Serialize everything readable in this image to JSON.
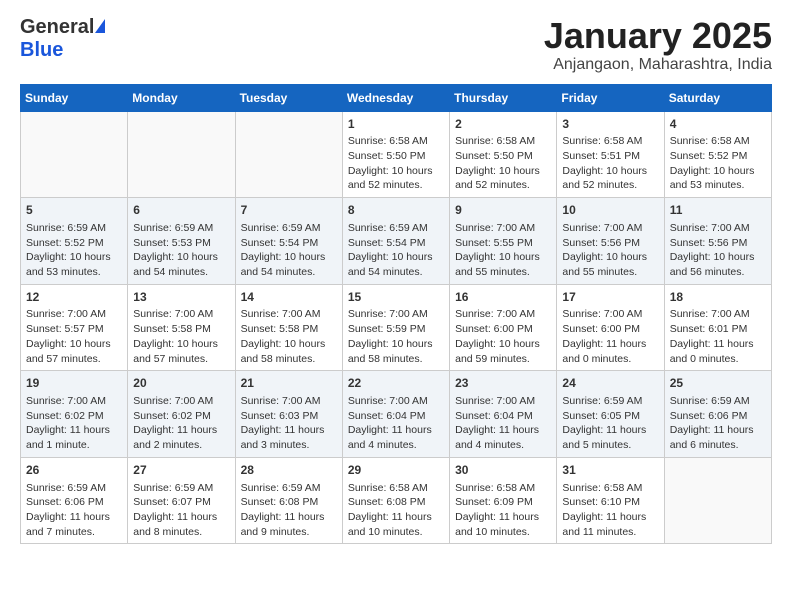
{
  "header": {
    "logo_general": "General",
    "logo_blue": "Blue",
    "month": "January 2025",
    "location": "Anjangaon, Maharashtra, India"
  },
  "weekdays": [
    "Sunday",
    "Monday",
    "Tuesday",
    "Wednesday",
    "Thursday",
    "Friday",
    "Saturday"
  ],
  "weeks": [
    [
      {
        "day": "",
        "lines": []
      },
      {
        "day": "",
        "lines": []
      },
      {
        "day": "",
        "lines": []
      },
      {
        "day": "1",
        "lines": [
          "Sunrise: 6:58 AM",
          "Sunset: 5:50 PM",
          "Daylight: 10 hours",
          "and 52 minutes."
        ]
      },
      {
        "day": "2",
        "lines": [
          "Sunrise: 6:58 AM",
          "Sunset: 5:50 PM",
          "Daylight: 10 hours",
          "and 52 minutes."
        ]
      },
      {
        "day": "3",
        "lines": [
          "Sunrise: 6:58 AM",
          "Sunset: 5:51 PM",
          "Daylight: 10 hours",
          "and 52 minutes."
        ]
      },
      {
        "day": "4",
        "lines": [
          "Sunrise: 6:58 AM",
          "Sunset: 5:52 PM",
          "Daylight: 10 hours",
          "and 53 minutes."
        ]
      }
    ],
    [
      {
        "day": "5",
        "lines": [
          "Sunrise: 6:59 AM",
          "Sunset: 5:52 PM",
          "Daylight: 10 hours",
          "and 53 minutes."
        ]
      },
      {
        "day": "6",
        "lines": [
          "Sunrise: 6:59 AM",
          "Sunset: 5:53 PM",
          "Daylight: 10 hours",
          "and 54 minutes."
        ]
      },
      {
        "day": "7",
        "lines": [
          "Sunrise: 6:59 AM",
          "Sunset: 5:54 PM",
          "Daylight: 10 hours",
          "and 54 minutes."
        ]
      },
      {
        "day": "8",
        "lines": [
          "Sunrise: 6:59 AM",
          "Sunset: 5:54 PM",
          "Daylight: 10 hours",
          "and 54 minutes."
        ]
      },
      {
        "day": "9",
        "lines": [
          "Sunrise: 7:00 AM",
          "Sunset: 5:55 PM",
          "Daylight: 10 hours",
          "and 55 minutes."
        ]
      },
      {
        "day": "10",
        "lines": [
          "Sunrise: 7:00 AM",
          "Sunset: 5:56 PM",
          "Daylight: 10 hours",
          "and 55 minutes."
        ]
      },
      {
        "day": "11",
        "lines": [
          "Sunrise: 7:00 AM",
          "Sunset: 5:56 PM",
          "Daylight: 10 hours",
          "and 56 minutes."
        ]
      }
    ],
    [
      {
        "day": "12",
        "lines": [
          "Sunrise: 7:00 AM",
          "Sunset: 5:57 PM",
          "Daylight: 10 hours",
          "and 57 minutes."
        ]
      },
      {
        "day": "13",
        "lines": [
          "Sunrise: 7:00 AM",
          "Sunset: 5:58 PM",
          "Daylight: 10 hours",
          "and 57 minutes."
        ]
      },
      {
        "day": "14",
        "lines": [
          "Sunrise: 7:00 AM",
          "Sunset: 5:58 PM",
          "Daylight: 10 hours",
          "and 58 minutes."
        ]
      },
      {
        "day": "15",
        "lines": [
          "Sunrise: 7:00 AM",
          "Sunset: 5:59 PM",
          "Daylight: 10 hours",
          "and 58 minutes."
        ]
      },
      {
        "day": "16",
        "lines": [
          "Sunrise: 7:00 AM",
          "Sunset: 6:00 PM",
          "Daylight: 10 hours",
          "and 59 minutes."
        ]
      },
      {
        "day": "17",
        "lines": [
          "Sunrise: 7:00 AM",
          "Sunset: 6:00 PM",
          "Daylight: 11 hours",
          "and 0 minutes."
        ]
      },
      {
        "day": "18",
        "lines": [
          "Sunrise: 7:00 AM",
          "Sunset: 6:01 PM",
          "Daylight: 11 hours",
          "and 0 minutes."
        ]
      }
    ],
    [
      {
        "day": "19",
        "lines": [
          "Sunrise: 7:00 AM",
          "Sunset: 6:02 PM",
          "Daylight: 11 hours",
          "and 1 minute."
        ]
      },
      {
        "day": "20",
        "lines": [
          "Sunrise: 7:00 AM",
          "Sunset: 6:02 PM",
          "Daylight: 11 hours",
          "and 2 minutes."
        ]
      },
      {
        "day": "21",
        "lines": [
          "Sunrise: 7:00 AM",
          "Sunset: 6:03 PM",
          "Daylight: 11 hours",
          "and 3 minutes."
        ]
      },
      {
        "day": "22",
        "lines": [
          "Sunrise: 7:00 AM",
          "Sunset: 6:04 PM",
          "Daylight: 11 hours",
          "and 4 minutes."
        ]
      },
      {
        "day": "23",
        "lines": [
          "Sunrise: 7:00 AM",
          "Sunset: 6:04 PM",
          "Daylight: 11 hours",
          "and 4 minutes."
        ]
      },
      {
        "day": "24",
        "lines": [
          "Sunrise: 6:59 AM",
          "Sunset: 6:05 PM",
          "Daylight: 11 hours",
          "and 5 minutes."
        ]
      },
      {
        "day": "25",
        "lines": [
          "Sunrise: 6:59 AM",
          "Sunset: 6:06 PM",
          "Daylight: 11 hours",
          "and 6 minutes."
        ]
      }
    ],
    [
      {
        "day": "26",
        "lines": [
          "Sunrise: 6:59 AM",
          "Sunset: 6:06 PM",
          "Daylight: 11 hours",
          "and 7 minutes."
        ]
      },
      {
        "day": "27",
        "lines": [
          "Sunrise: 6:59 AM",
          "Sunset: 6:07 PM",
          "Daylight: 11 hours",
          "and 8 minutes."
        ]
      },
      {
        "day": "28",
        "lines": [
          "Sunrise: 6:59 AM",
          "Sunset: 6:08 PM",
          "Daylight: 11 hours",
          "and 9 minutes."
        ]
      },
      {
        "day": "29",
        "lines": [
          "Sunrise: 6:58 AM",
          "Sunset: 6:08 PM",
          "Daylight: 11 hours",
          "and 10 minutes."
        ]
      },
      {
        "day": "30",
        "lines": [
          "Sunrise: 6:58 AM",
          "Sunset: 6:09 PM",
          "Daylight: 11 hours",
          "and 10 minutes."
        ]
      },
      {
        "day": "31",
        "lines": [
          "Sunrise: 6:58 AM",
          "Sunset: 6:10 PM",
          "Daylight: 11 hours",
          "and 11 minutes."
        ]
      },
      {
        "day": "",
        "lines": []
      }
    ]
  ]
}
